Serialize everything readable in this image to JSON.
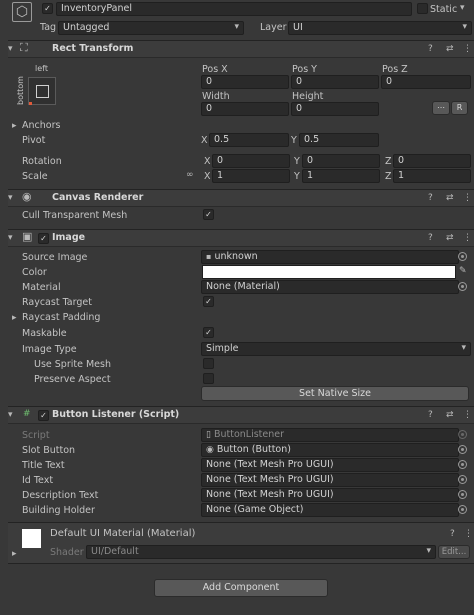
{
  "header": {
    "name": "InventoryPanel",
    "static_label": "Static",
    "tag_label": "Tag",
    "tag_value": "Untagged",
    "layer_label": "Layer",
    "layer_value": "UI"
  },
  "rect_transform": {
    "title": "Rect Transform",
    "anchor_h": "left",
    "anchor_v": "bottom",
    "pos_x_label": "Pos X",
    "pos_y_label": "Pos Y",
    "pos_z_label": "Pos Z",
    "pos_x": "0",
    "pos_y": "0",
    "pos_z": "0",
    "width_label": "Width",
    "height_label": "Height",
    "width": "0",
    "height": "0",
    "r_button": "R",
    "anchors_label": "Anchors",
    "pivot_label": "Pivot",
    "pivot_x": "0.5",
    "pivot_y": "0.5",
    "rotation_label": "Rotation",
    "rot_x": "0",
    "rot_y": "0",
    "rot_z": "0",
    "scale_label": "Scale",
    "scale_x": "1",
    "scale_y": "1",
    "scale_z": "1",
    "x": "X",
    "y": "Y",
    "z": "Z"
  },
  "canvas_renderer": {
    "title": "Canvas Renderer",
    "cull_label": "Cull Transparent Mesh",
    "cull": true
  },
  "image": {
    "title": "Image",
    "source_image_label": "Source Image",
    "source_image": "unknown",
    "color_label": "Color",
    "color": "#ffffff",
    "material_label": "Material",
    "material": "None (Material)",
    "raycast_target_label": "Raycast Target",
    "raycast_target": true,
    "raycast_padding_label": "Raycast Padding",
    "maskable_label": "Maskable",
    "maskable": true,
    "image_type_label": "Image Type",
    "image_type": "Simple",
    "use_sprite_mesh_label": "Use Sprite Mesh",
    "use_sprite_mesh": false,
    "preserve_aspect_label": "Preserve Aspect",
    "preserve_aspect": false,
    "set_native_size": "Set Native Size"
  },
  "button_listener": {
    "title": "Button Listener (Script)",
    "script_label": "Script",
    "script": "ButtonListener",
    "slot_button_label": "Slot Button",
    "slot_button": "Button (Button)",
    "title_text_label": "Title Text",
    "title_text": "None (Text Mesh Pro UGUI)",
    "id_text_label": "Id Text",
    "id_text": "None (Text Mesh Pro UGUI)",
    "description_text_label": "Description Text",
    "description_text": "None (Text Mesh Pro UGUI)",
    "building_holder_label": "Building Holder",
    "building_holder": "None (Game Object)"
  },
  "material": {
    "title": "Default UI Material (Material)",
    "shader_label": "Shader",
    "shader": "UI/Default",
    "edit": "Edit..."
  },
  "add_component": "Add Component"
}
